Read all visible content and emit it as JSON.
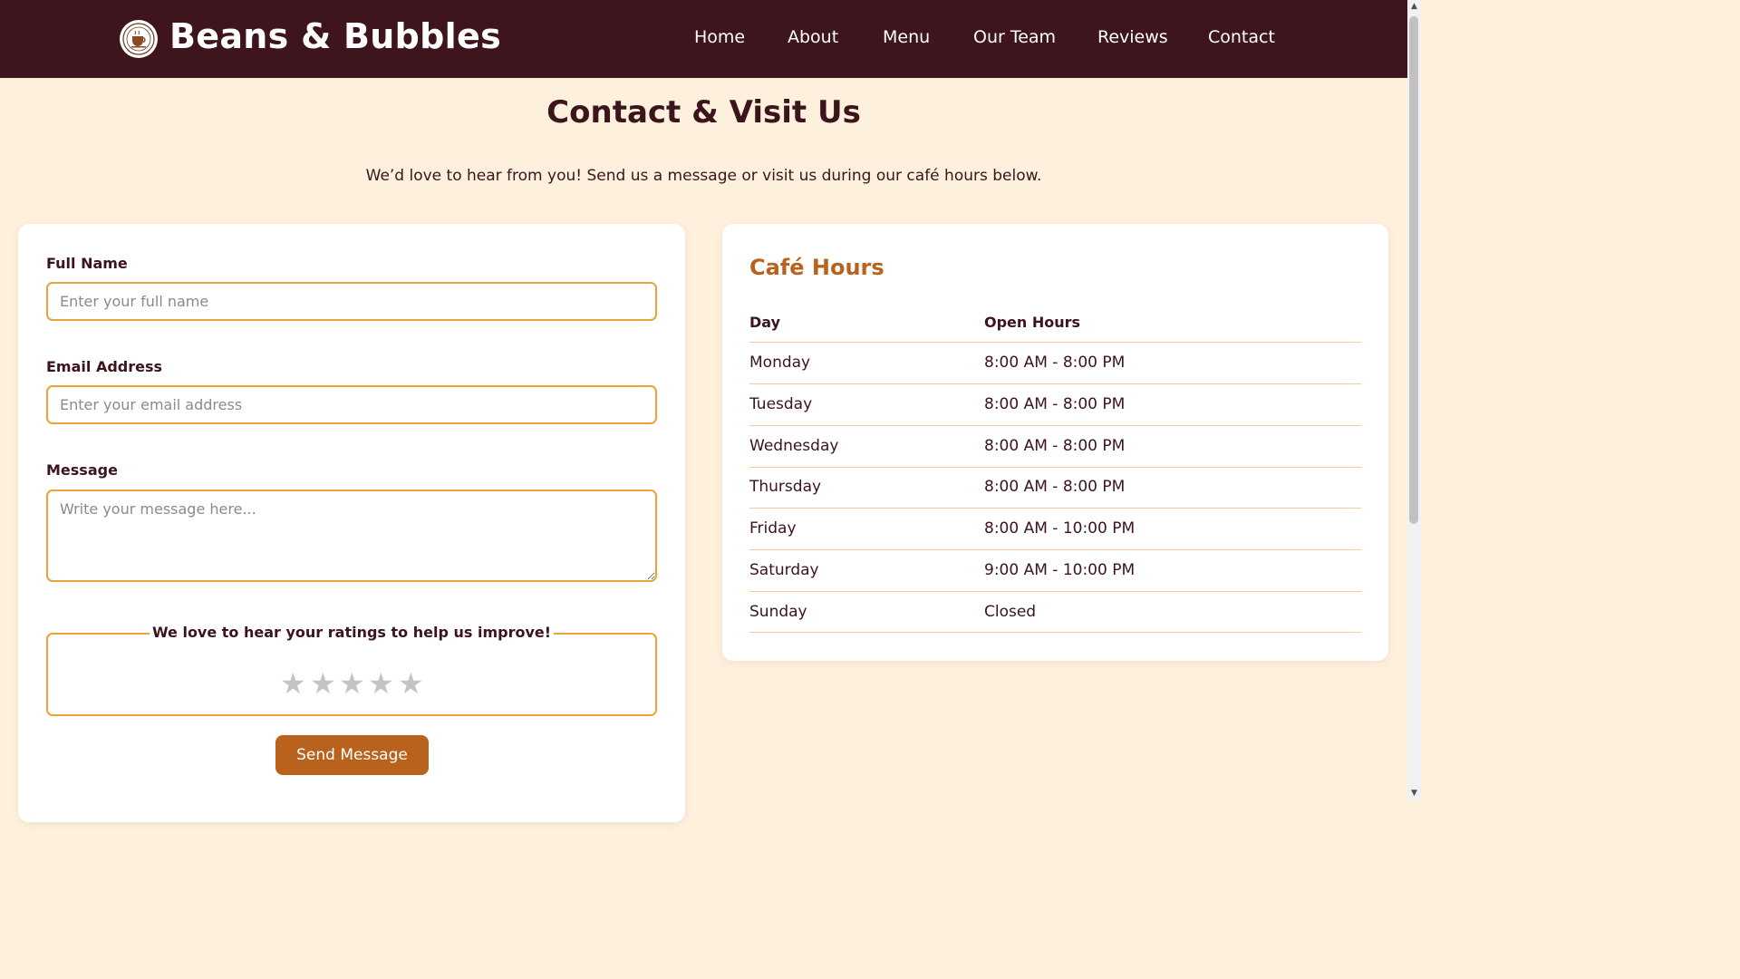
{
  "header": {
    "brand": "Beans & Bubbles",
    "nav": [
      "Home",
      "About",
      "Menu",
      "Our Team",
      "Reviews",
      "Contact"
    ]
  },
  "page": {
    "title": "Contact & Visit Us",
    "subtitle": "We’d love to hear from you! Send us a message or visit us during our café hours below."
  },
  "form": {
    "name_label": "Full Name",
    "name_placeholder": "Enter your full name",
    "email_label": "Email Address",
    "email_placeholder": "Enter your email address",
    "message_label": "Message",
    "message_placeholder": "Write your message here...",
    "rating_legend": "We love to hear your ratings to help us improve!",
    "rating_max": 5,
    "rating_value": 0,
    "send_label": "Send Message"
  },
  "hours": {
    "title": "Café Hours",
    "col_day": "Day",
    "col_hours": "Open Hours",
    "rows": [
      {
        "day": "Monday",
        "hours": "8:00 AM - 8:00 PM"
      },
      {
        "day": "Tuesday",
        "hours": "8:00 AM - 8:00 PM"
      },
      {
        "day": "Wednesday",
        "hours": "8:00 AM - 8:00 PM"
      },
      {
        "day": "Thursday",
        "hours": "8:00 AM - 8:00 PM"
      },
      {
        "day": "Friday",
        "hours": "8:00 AM - 10:00 PM"
      },
      {
        "day": "Saturday",
        "hours": "9:00 AM - 10:00 PM"
      },
      {
        "day": "Sunday",
        "hours": "Closed"
      }
    ]
  },
  "colors": {
    "header_bg": "#3e141d",
    "page_bg": "#fdf0dc",
    "accent": "#b8621e",
    "field_border": "#e9a33a",
    "text_dark": "#3b141c"
  },
  "icons": {
    "logo": "coffee-cup-logo-icon",
    "star": "star-icon"
  }
}
